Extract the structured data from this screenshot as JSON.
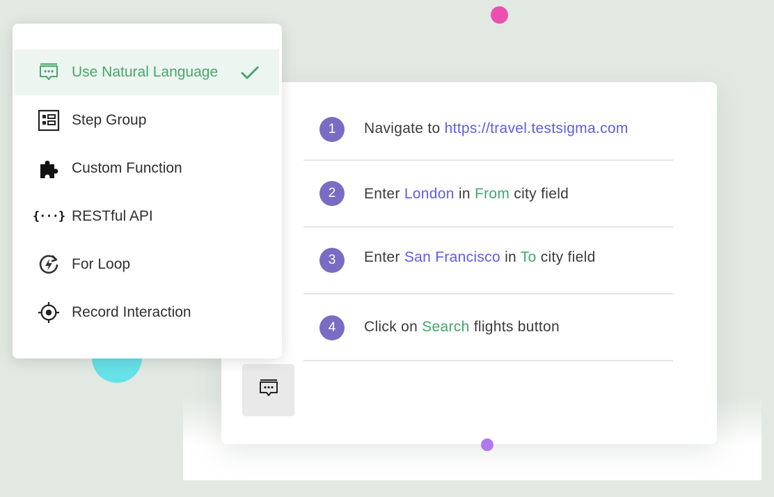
{
  "menu": {
    "items": [
      {
        "label": "Use Natural Language",
        "icon": "chat-message-icon",
        "selected": true
      },
      {
        "label": "Step Group",
        "icon": "step-group-icon",
        "selected": false
      },
      {
        "label": "Custom Function",
        "icon": "puzzle-icon",
        "selected": false
      },
      {
        "label": "RESTful API",
        "icon": "curly-braces-icon",
        "selected": false
      },
      {
        "label": "For Loop",
        "icon": "loop-bolt-icon",
        "selected": false
      },
      {
        "label": "Record Interaction",
        "icon": "crosshair-icon",
        "selected": false
      }
    ],
    "brace_glyph": "{···}"
  },
  "steps": [
    {
      "number": "1",
      "parts": [
        "Navigate to ",
        "https://travel.testsigma.com"
      ]
    },
    {
      "number": "2",
      "parts": [
        "Enter ",
        "London",
        " in ",
        "From",
        " city field"
      ]
    },
    {
      "number": "3",
      "parts": [
        "Enter ",
        "San Francisco",
        " in ",
        "To",
        " city field"
      ]
    },
    {
      "number": "4",
      "parts": [
        "Click on ",
        "Search",
        " flights button"
      ]
    }
  ],
  "colors": {
    "accent_green": "#3ea868",
    "accent_blue": "#5b5ee6",
    "step_badge": "#7a6cc4",
    "selected_bg": "#ecf5ef",
    "dot_pink": "#ec4fb0",
    "dot_cyan": "#66e2e8",
    "dot_purple": "#b078ee"
  }
}
